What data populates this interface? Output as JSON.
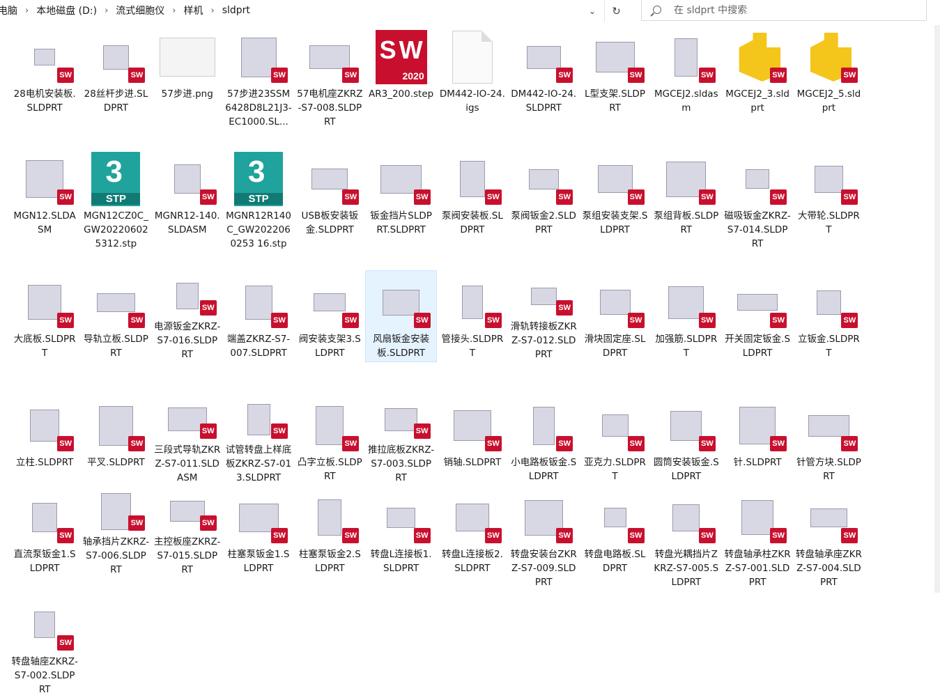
{
  "breadcrumb": [
    "电脑",
    "本地磁盘 (D:)",
    "流式细胞仪",
    "样机",
    "sldprt"
  ],
  "search": {
    "placeholder": "在 sldprt 中搜索"
  },
  "files": [
    {
      "name": "28电机安装板.SLDPRT",
      "icon": "sw-part"
    },
    {
      "name": "28丝杆步进.SLDPRT",
      "icon": "sw-part"
    },
    {
      "name": "57步进.png",
      "icon": "png"
    },
    {
      "name": "57步进23SSM6428D8L21J3-EC1000.SL...",
      "icon": "sw-part"
    },
    {
      "name": "57电机座ZKRZ-S7-008.SLDPRT",
      "icon": "sw-part"
    },
    {
      "name": "AR3_200.step",
      "icon": "sw-2020"
    },
    {
      "name": "DM442-IO-24.igs",
      "icon": "doc"
    },
    {
      "name": "DM442-IO-24.SLDPRT",
      "icon": "sw-part"
    },
    {
      "name": "L型支架.SLDPRT",
      "icon": "sw-part"
    },
    {
      "name": "MGCEJ2.sldasm",
      "icon": "sw-asm"
    },
    {
      "name": "MGCEJ2_3.sldprt",
      "icon": "yellow"
    },
    {
      "name": "MGCEJ2_5.sldprt",
      "icon": "yellow"
    },
    {
      "name": "MGN12.SLDASM",
      "icon": "sw-asm"
    },
    {
      "name": "MGN12CZ0C_GW202206025312.stp",
      "icon": "stp"
    },
    {
      "name": "MGNR12-140.SLDASM",
      "icon": "sw-asm"
    },
    {
      "name": "MGNR12R140C_GW2022060253 16.stp",
      "icon": "stp"
    },
    {
      "name": "USB板安装钣金.SLDPRT",
      "icon": "sw-part"
    },
    {
      "name": "钣金挡片SLDPRT.SLDPRT",
      "icon": "sw-part"
    },
    {
      "name": "泵阀安装板.SLDPRT",
      "icon": "sw-part"
    },
    {
      "name": "泵阀钣金2.SLDPRT",
      "icon": "sw-part"
    },
    {
      "name": "泵组安装支架.SLDPRT",
      "icon": "sw-part"
    },
    {
      "name": "泵组背板.SLDPRT",
      "icon": "sw-part"
    },
    {
      "name": "磁吸钣金ZKRZ-S7-014.SLDPRT",
      "icon": "sw-part"
    },
    {
      "name": "大带轮.SLDPRT",
      "icon": "sw-part"
    },
    {
      "name": "大底板.SLDPRT",
      "icon": "sw-part"
    },
    {
      "name": "导轨立板.SLDPRT",
      "icon": "sw-part"
    },
    {
      "name": "电源钣金ZKRZ-S7-016.SLDPRT",
      "icon": "sw-part"
    },
    {
      "name": "端盖ZKRZ-S7-007.SLDPRT",
      "icon": "sw-part"
    },
    {
      "name": "阀安装支架3.SLDPRT",
      "icon": "sw-part"
    },
    {
      "name": "风扇钣金安装板.SLDPRT",
      "icon": "sw-part",
      "selected": true
    },
    {
      "name": "管接头.SLDPRT",
      "icon": "sw-part"
    },
    {
      "name": "滑轨转接板ZKRZ-S7-012.SLDPRT",
      "icon": "sw-part"
    },
    {
      "name": "滑块固定座.SLDPRT",
      "icon": "sw-part"
    },
    {
      "name": "加强筋.SLDPRT",
      "icon": "sw-part"
    },
    {
      "name": "开关固定钣金.SLDPRT",
      "icon": "sw-part"
    },
    {
      "name": "立钣金.SLDPRT",
      "icon": "sw-part"
    },
    {
      "name": "立柱.SLDPRT",
      "icon": "sw-part"
    },
    {
      "name": "平叉.SLDPRT",
      "icon": "sw-part"
    },
    {
      "name": "三段式导轨ZKRZ-S7-011.SLDASM",
      "icon": "sw-asm"
    },
    {
      "name": "试管转盘上样底板ZKRZ-S7-013.SLDPRT",
      "icon": "sw-part"
    },
    {
      "name": "凸字立板.SLDPRT",
      "icon": "sw-part"
    },
    {
      "name": "推拉底板ZKRZ-S7-003.SLDPRT",
      "icon": "sw-part"
    },
    {
      "name": "销轴.SLDPRT",
      "icon": "sw-part"
    },
    {
      "name": "小电路板钣金.SLDPRT",
      "icon": "sw-part"
    },
    {
      "name": "亚克力.SLDPRT",
      "icon": "sw-part"
    },
    {
      "name": "圆筒安装钣金.SLDPRT",
      "icon": "sw-part"
    },
    {
      "name": "针.SLDPRT",
      "icon": "sw-part"
    },
    {
      "name": "针管方块.SLDPRT",
      "icon": "sw-part"
    },
    {
      "name": "直流泵钣金1.SLDPRT",
      "icon": "sw-part"
    },
    {
      "name": "轴承挡片ZKRZ-S7-006.SLDPRT",
      "icon": "sw-part"
    },
    {
      "name": "主控板座ZKRZ-S7-015.SLDPRT",
      "icon": "sw-part"
    },
    {
      "name": "柱塞泵钣金1.SLDPRT",
      "icon": "sw-part"
    },
    {
      "name": "柱塞泵钣金2.SLDPRT",
      "icon": "sw-part"
    },
    {
      "name": "转盘L连接板1.SLDPRT",
      "icon": "sw-part"
    },
    {
      "name": "转盘L连接板2.SLDPRT",
      "icon": "sw-part"
    },
    {
      "name": "转盘安装台ZKRZ-S7-009.SLDPRT",
      "icon": "sw-part"
    },
    {
      "name": "转盘电路板.SLDPRT",
      "icon": "sw-part"
    },
    {
      "name": "转盘光耦挡片ZKRZ-S7-005.SLDPRT",
      "icon": "sw-part"
    },
    {
      "name": "转盘轴承柱ZKRZ-S7-001.SLDPRT",
      "icon": "sw-part"
    },
    {
      "name": "转盘轴承座ZKRZ-S7-004.SLDPRT",
      "icon": "sw-part"
    },
    {
      "name": "转盘轴座ZKRZ-S7-002.SLDPRT",
      "icon": "sw-part"
    }
  ],
  "badge_text": "SW",
  "sw_year": "2020",
  "stp_text": "STP",
  "stp_number": "3"
}
